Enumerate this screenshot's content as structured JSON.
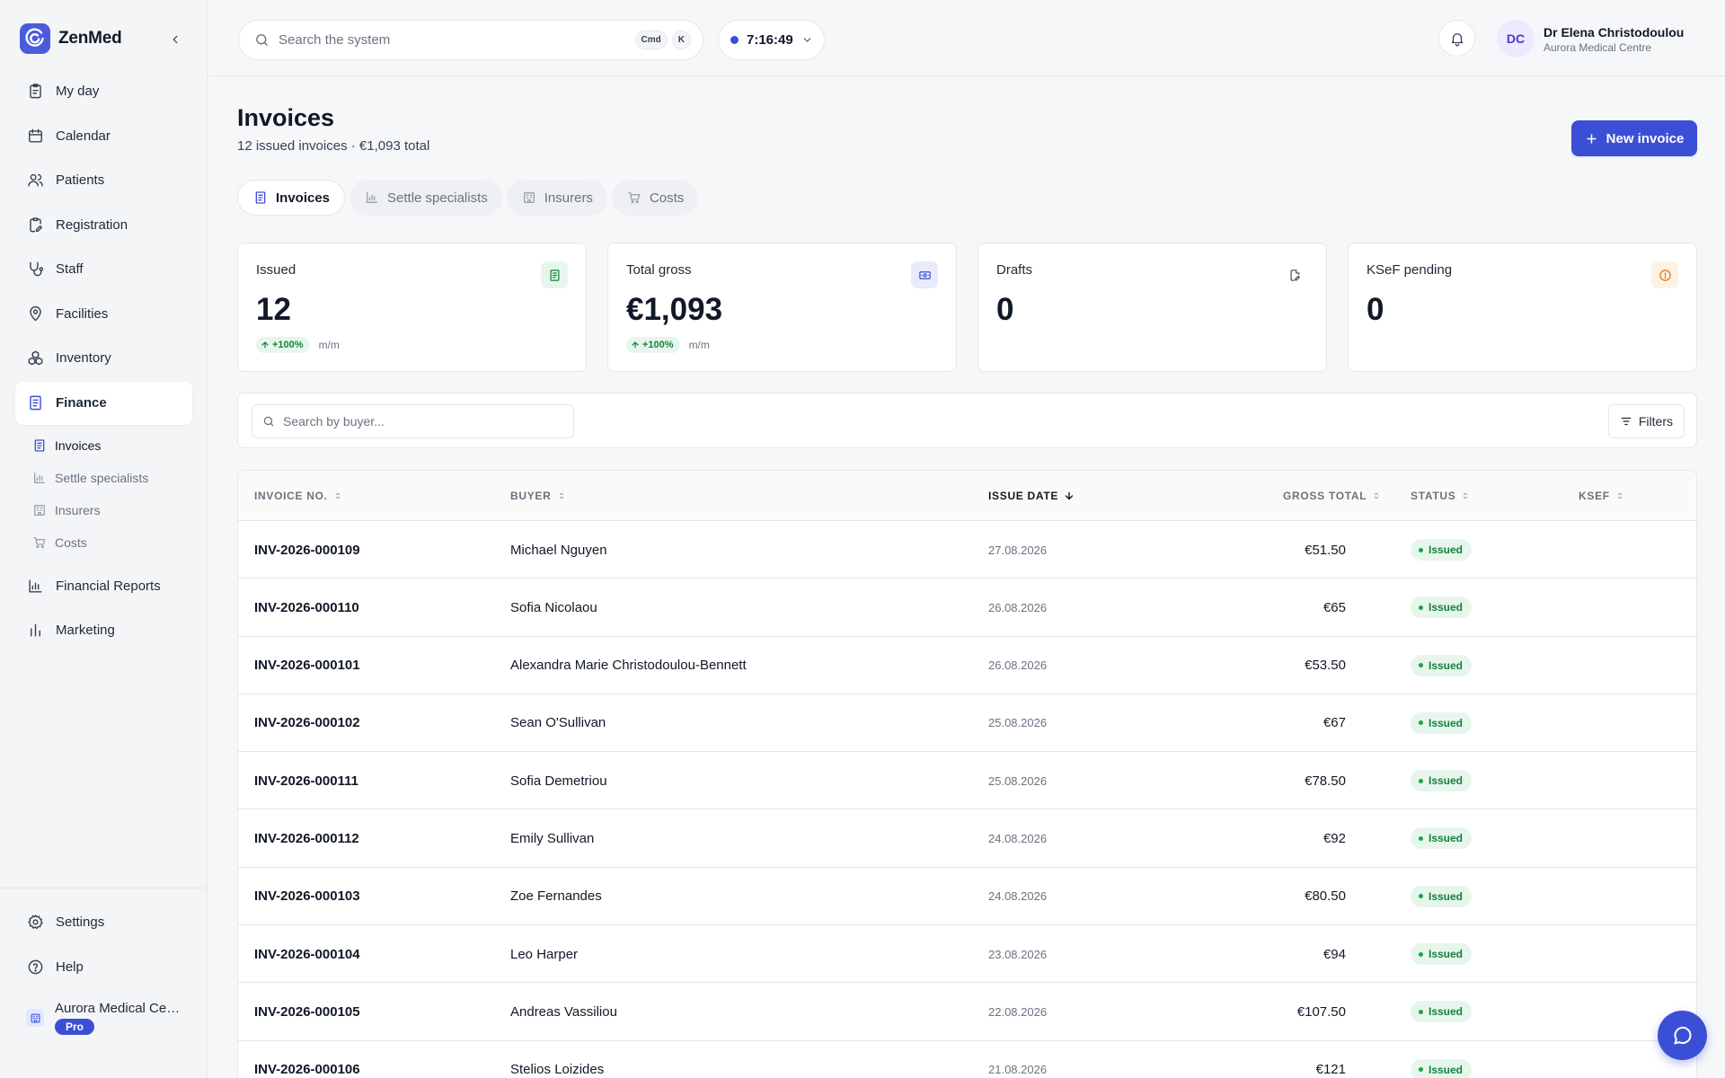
{
  "app": {
    "name": "ZenMed"
  },
  "sidebar": {
    "items": [
      {
        "label": "My day",
        "icon": "clipboard-icon"
      },
      {
        "label": "Calendar",
        "icon": "calendar-icon"
      },
      {
        "label": "Patients",
        "icon": "users-icon"
      },
      {
        "label": "Registration",
        "icon": "clipboard-edit-icon"
      },
      {
        "label": "Staff",
        "icon": "stethoscope-icon"
      },
      {
        "label": "Facilities",
        "icon": "map-pin-icon"
      },
      {
        "label": "Inventory",
        "icon": "boxes-icon"
      },
      {
        "label": "Finance",
        "icon": "receipt-icon"
      }
    ],
    "finance_sub": [
      {
        "label": "Invoices",
        "icon": "receipt-icon"
      },
      {
        "label": "Settle specialists",
        "icon": "bar-chart-icon"
      },
      {
        "label": "Insurers",
        "icon": "building-icon"
      },
      {
        "label": "Costs",
        "icon": "cart-icon"
      }
    ],
    "items_after": [
      {
        "label": "Financial Reports",
        "icon": "bar-chart-icon"
      },
      {
        "label": "Marketing",
        "icon": "bar-chart-alt-icon"
      }
    ],
    "settings_label": "Settings",
    "help_label": "Help",
    "org_name": "Aurora Medical Centre",
    "org_plan": "Pro"
  },
  "topbar": {
    "search_placeholder": "Search the system",
    "kbd_cmd": "Cmd",
    "kbd_k": "K",
    "timer": "7:16:49",
    "avatar_initials": "DC",
    "user_name": "Dr Elena Christodoulou",
    "user_org": "Aurora Medical Centre"
  },
  "page": {
    "title": "Invoices",
    "subtitle": "12 issued invoices · €1,093 total",
    "new_button": "New invoice"
  },
  "tabs": [
    {
      "label": "Invoices",
      "icon": "receipt-icon",
      "active": true
    },
    {
      "label": "Settle specialists",
      "icon": "bar-chart-icon"
    },
    {
      "label": "Insurers",
      "icon": "building-icon"
    },
    {
      "label": "Costs",
      "icon": "cart-icon"
    }
  ],
  "cards": [
    {
      "label": "Issued",
      "value": "12",
      "trend": "+100%",
      "period": "m/m",
      "icon": "receipt-icon",
      "icon_color": "#16803d",
      "icon_bg": "#e6f6ec"
    },
    {
      "label": "Total gross",
      "value": "€1,093",
      "trend": "+100%",
      "period": "m/m",
      "icon": "banknote-icon",
      "icon_color": "#3b4fd6",
      "icon_bg": "#e8ebfb"
    },
    {
      "label": "Drafts",
      "value": "0",
      "icon": "file-edit-icon",
      "icon_color": "#4b5563",
      "icon_bg": "#ffffff"
    },
    {
      "label": "KSeF pending",
      "value": "0",
      "icon": "alert-circle-icon",
      "icon_color": "#d97706",
      "icon_bg": "#fdf3e3"
    }
  ],
  "filter": {
    "search_placeholder": "Search by buyer...",
    "filters_label": "Filters"
  },
  "table": {
    "headers": {
      "number": "INVOICE NO.",
      "buyer": "BUYER",
      "date": "ISSUE DATE",
      "gross": "GROSS TOTAL",
      "status": "STATUS",
      "ksef": "KSEF"
    },
    "rows": [
      {
        "number": "INV-2026-000109",
        "buyer": "Michael Nguyen",
        "date": "27.08.2026",
        "gross": "€51.50",
        "status": "Issued"
      },
      {
        "number": "INV-2026-000110",
        "buyer": "Sofia Nicolaou",
        "date": "26.08.2026",
        "gross": "€65",
        "status": "Issued"
      },
      {
        "number": "INV-2026-000101",
        "buyer": "Alexandra Marie Christodoulou-Bennett",
        "date": "26.08.2026",
        "gross": "€53.50",
        "status": "Issued"
      },
      {
        "number": "INV-2026-000102",
        "buyer": "Sean O'Sullivan",
        "date": "25.08.2026",
        "gross": "€67",
        "status": "Issued"
      },
      {
        "number": "INV-2026-000111",
        "buyer": "Sofia Demetriou",
        "date": "25.08.2026",
        "gross": "€78.50",
        "status": "Issued"
      },
      {
        "number": "INV-2026-000112",
        "buyer": "Emily Sullivan",
        "date": "24.08.2026",
        "gross": "€92",
        "status": "Issued"
      },
      {
        "number": "INV-2026-000103",
        "buyer": "Zoe Fernandes",
        "date": "24.08.2026",
        "gross": "€80.50",
        "status": "Issued"
      },
      {
        "number": "INV-2026-000104",
        "buyer": "Leo Harper",
        "date": "23.08.2026",
        "gross": "€94",
        "status": "Issued"
      },
      {
        "number": "INV-2026-000105",
        "buyer": "Andreas Vassiliou",
        "date": "22.08.2026",
        "gross": "€107.50",
        "status": "Issued"
      },
      {
        "number": "INV-2026-000106",
        "buyer": "Stelios Loizides",
        "date": "21.08.2026",
        "gross": "€121",
        "status": "Issued"
      }
    ]
  },
  "colors": {
    "accent": "#3b4fd6",
    "success": "#16803d",
    "success_bg": "#e6f6ec"
  }
}
